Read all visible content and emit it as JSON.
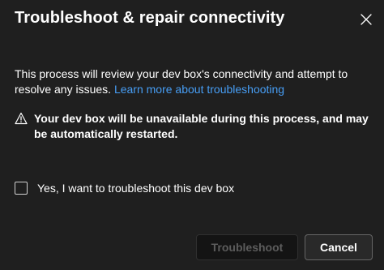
{
  "dialog": {
    "title": "Troubleshoot & repair connectivity",
    "close_icon": "close-icon",
    "description": "This process will review your dev box's connectivity and attempt to resolve any issues.",
    "link_text": "Learn more about troubleshooting",
    "warning_icon": "warning-icon",
    "warning_text": "Your dev box will be unavailable during this process, and may be automatically restarted.",
    "checkbox_label": "Yes, I want to troubleshoot this dev box",
    "checkbox_checked": false,
    "primary_button": "Troubleshoot",
    "primary_disabled": true,
    "secondary_button": "Cancel"
  },
  "colors": {
    "background": "#1f1f1f",
    "link": "#479ef5",
    "text": "#ffffff",
    "disabled_text": "#5c5c5c"
  }
}
